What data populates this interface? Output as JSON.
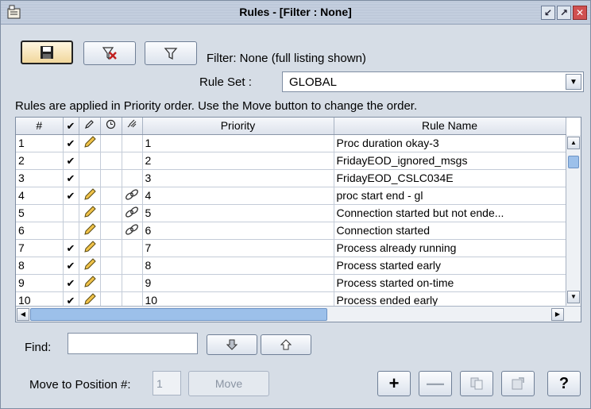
{
  "window": {
    "title": "Rules - [Filter : None]",
    "controls": [
      "minimize-icon",
      "maximize-icon",
      "close-icon"
    ]
  },
  "toolbar": {
    "save_icon": "floppy-save-icon",
    "clear_filter_icon": "clear-filter-icon",
    "filter_icon": "funnel-filter-icon",
    "filter_status": "Filter: None (full listing shown)"
  },
  "ruleset": {
    "label": "Rule Set :",
    "value": "GLOBAL"
  },
  "info_text": "Rules are applied in Priority order.  Use the Move button to change the order.",
  "table": {
    "columns": [
      "#",
      "✔",
      "pencil-icon",
      "clock-icon",
      "link-icon",
      "Priority",
      "Rule Name"
    ],
    "rows": [
      {
        "num": "1",
        "enabled": "✔",
        "edit": true,
        "sched": false,
        "linked": false,
        "priority": "1",
        "name": "Proc duration okay-3"
      },
      {
        "num": "2",
        "enabled": "✔",
        "edit": false,
        "sched": false,
        "linked": false,
        "priority": "2",
        "name": "FridayEOD_ignored_msgs"
      },
      {
        "num": "3",
        "enabled": "✔",
        "edit": false,
        "sched": false,
        "linked": false,
        "priority": "3",
        "name": "FridayEOD_CSLC034E"
      },
      {
        "num": "4",
        "enabled": "✔",
        "edit": true,
        "sched": false,
        "linked": true,
        "priority": "4",
        "name": "proc start end - gl"
      },
      {
        "num": "5",
        "enabled": "",
        "edit": true,
        "sched": false,
        "linked": true,
        "priority": "5",
        "name": "Connection started but not ende..."
      },
      {
        "num": "6",
        "enabled": "",
        "edit": true,
        "sched": false,
        "linked": true,
        "priority": "6",
        "name": "Connection started"
      },
      {
        "num": "7",
        "enabled": "✔",
        "edit": true,
        "sched": false,
        "linked": false,
        "priority": "7",
        "name": "Process already running"
      },
      {
        "num": "8",
        "enabled": "✔",
        "edit": true,
        "sched": false,
        "linked": false,
        "priority": "8",
        "name": "Process started early"
      },
      {
        "num": "9",
        "enabled": "✔",
        "edit": true,
        "sched": false,
        "linked": false,
        "priority": "9",
        "name": "Process started on-time"
      },
      {
        "num": "10",
        "enabled": "✔",
        "edit": true,
        "sched": false,
        "linked": false,
        "priority": "10",
        "name": "Process ended early"
      }
    ]
  },
  "find": {
    "label": "Find:",
    "value": "",
    "down_icon": "arrow-down-icon",
    "up_icon": "arrow-up-icon"
  },
  "move": {
    "label": "Move to Position #:",
    "position_value": "1",
    "button_label": "Move"
  },
  "actions": {
    "add_label": "+",
    "remove_label": "—",
    "copy_icon": "copy-icon",
    "properties_icon": "properties-icon",
    "help_label": "?"
  }
}
